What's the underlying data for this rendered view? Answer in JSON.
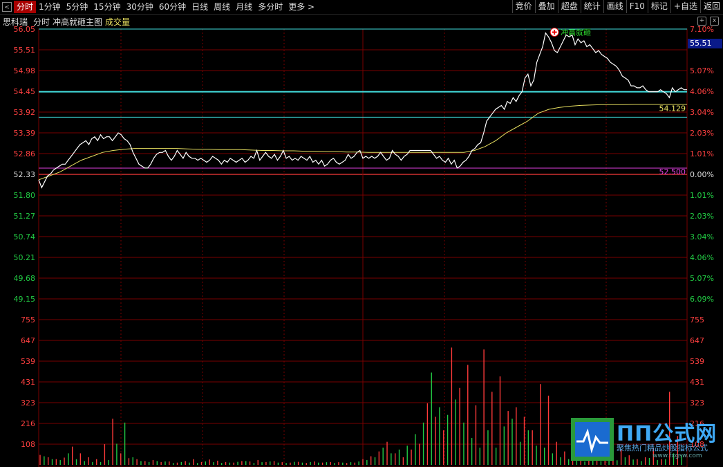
{
  "toolbar": {
    "back_glyph": "<",
    "tabs": [
      "分时",
      "1分钟",
      "5分钟",
      "15分钟",
      "30分钟",
      "60分钟",
      "日线",
      "周线",
      "月线",
      "多分时",
      "更多 >"
    ],
    "active_tab": 0,
    "right_buttons": [
      "竞价",
      "叠加",
      "超盘",
      "统计",
      "画线",
      "F10",
      "标记",
      "+自选",
      "返回"
    ]
  },
  "info": {
    "stock_name": "思科瑞",
    "mode": "分时",
    "indicator": "冲高就砸主图",
    "volume_label": "成交量"
  },
  "controls": {
    "add": "+",
    "close": "x"
  },
  "price_tag": "55.51",
  "colors": {
    "up": "#ff3a3a",
    "down": "#22cc44",
    "price_line": "#ffffff",
    "avg_line": "#e8e060",
    "grid": "#7a0000",
    "cyan": "#40e0e0",
    "magenta": "#e040e0"
  },
  "logo": {
    "title": "ΠΠ公式网",
    "subtitle": "聚焦热门精品炒股指标公式",
    "url": "www.fxgsw.com"
  },
  "chart_data": {
    "type": "line",
    "title": "",
    "price_axis": {
      "left": [
        "56.05",
        "55.51",
        "54.98",
        "54.45",
        "53.92",
        "53.39",
        "52.86",
        "52.33",
        "51.80",
        "51.27",
        "50.74",
        "50.21",
        "49.68",
        "49.15"
      ],
      "right": [
        "7.10%",
        "6.09%",
        "5.07%",
        "4.06%",
        "3.04%",
        "2.03%",
        "1.01%",
        "0.00%",
        "1.01%",
        "2.03%",
        "3.04%",
        "4.06%",
        "5.07%",
        "6.09%"
      ]
    },
    "volume_axis": [
      "755",
      "647",
      "539",
      "431",
      "323",
      "216",
      "108"
    ],
    "prev_close": 52.33,
    "level_lines": [
      {
        "value": 56.05
      },
      {
        "value": 54.45
      },
      {
        "value": 53.8
      },
      {
        "value": 52.5,
        "label": "52.500"
      }
    ],
    "avg_label": "54.129",
    "signal": {
      "text": "冲高就砸",
      "time_index": 175,
      "price": 55.9
    },
    "price_series": [
      52.2,
      52.0,
      52.15,
      52.3,
      52.35,
      52.45,
      52.5,
      52.55,
      52.6,
      52.6,
      52.7,
      52.8,
      52.9,
      53.0,
      53.1,
      53.15,
      53.2,
      53.1,
      53.25,
      53.3,
      53.2,
      53.35,
      53.25,
      53.3,
      53.3,
      53.2,
      53.3,
      53.4,
      53.35,
      53.25,
      53.2,
      53.1,
      52.9,
      52.75,
      52.6,
      52.55,
      52.5,
      52.5,
      52.6,
      52.75,
      52.85,
      52.9,
      52.9,
      52.95,
      52.8,
      52.7,
      52.8,
      52.95,
      52.85,
      52.75,
      52.9,
      52.8,
      52.75,
      52.75,
      52.7,
      52.75,
      52.7,
      52.65,
      52.7,
      52.8,
      52.75,
      52.7,
      52.6,
      52.7,
      52.65,
      52.75,
      52.7,
      52.65,
      52.7,
      52.75,
      52.65,
      52.7,
      52.8,
      52.75,
      52.95,
      52.7,
      52.8,
      52.9,
      52.8,
      52.75,
      52.85,
      52.7,
      52.8,
      52.95,
      52.75,
      52.8,
      52.7,
      52.75,
      52.7,
      52.8,
      52.75,
      52.7,
      52.8,
      52.65,
      52.7,
      52.6,
      52.7,
      52.55,
      52.6,
      52.7,
      52.75,
      52.65,
      52.6,
      52.65,
      52.7,
      52.85,
      52.75,
      52.8,
      52.9,
      52.95,
      52.75,
      52.8,
      52.75,
      52.8,
      52.75,
      52.8,
      52.9,
      52.8,
      52.7,
      52.75,
      52.95,
      52.85,
      52.8,
      52.7,
      52.8,
      52.85,
      52.95,
      52.95,
      52.95,
      52.95,
      52.95,
      52.95,
      52.95,
      52.95,
      52.85,
      52.75,
      52.8,
      52.7,
      52.65,
      52.75,
      52.6,
      52.7,
      52.5,
      52.55,
      52.65,
      52.7,
      52.8,
      52.95,
      53.0,
      53.1,
      53.15,
      53.4,
      53.7,
      53.8,
      53.9,
      54.0,
      54.05,
      54.1,
      54.0,
      54.2,
      54.15,
      54.3,
      54.2,
      54.35,
      54.45,
      54.8,
      54.9,
      54.6,
      54.75,
      55.2,
      55.4,
      55.6,
      55.95,
      55.85,
      55.7,
      55.5,
      55.45,
      55.6,
      55.75,
      55.9,
      55.85,
      55.9,
      55.65,
      55.8,
      55.7,
      55.75,
      55.6,
      55.65,
      55.55,
      55.45,
      55.5,
      55.4,
      55.35,
      55.3,
      55.2,
      55.15,
      55.1,
      55.0,
      54.85,
      54.8,
      54.75,
      54.6,
      54.6,
      54.55,
      54.55,
      54.6,
      54.5,
      54.45,
      54.45,
      54.45,
      54.45,
      54.5,
      54.45,
      54.4,
      54.3,
      54.55,
      54.45,
      54.5,
      54.55,
      54.5,
      54.5
    ],
    "avg_series": [
      52.2,
      52.3,
      52.4,
      52.55,
      52.7,
      52.8,
      52.9,
      52.95,
      52.98,
      53.0,
      53.0,
      53.0,
      53.0,
      53.0,
      52.99,
      52.98,
      52.98,
      52.97,
      52.97,
      52.97,
      52.96,
      52.95,
      52.95,
      52.94,
      52.94,
      52.93,
      52.93,
      52.92,
      52.92,
      52.91,
      52.91,
      52.9,
      52.9,
      52.9,
      52.9,
      52.9,
      52.9,
      52.9,
      52.9,
      52.9,
      52.9,
      52.95,
      53.05,
      53.2,
      53.4,
      53.55,
      53.7,
      53.9,
      54.0,
      54.05,
      54.08,
      54.1,
      54.11,
      54.12,
      54.12,
      54.12,
      54.13,
      54.13,
      54.13,
      54.13,
      54.13,
      54.13
    ],
    "volume": {
      "up": [
        52,
        40,
        30,
        38,
        95,
        60,
        40,
        30,
        108,
        240,
        60,
        35,
        30,
        20,
        25,
        15,
        18,
        12,
        20,
        30,
        15,
        28,
        22,
        15,
        12,
        20,
        18,
        25,
        15,
        20,
        14,
        12,
        16,
        10,
        18,
        12,
        15,
        14,
        10,
        12,
        30,
        45,
        70,
        120,
        60,
        40,
        80,
        110,
        320,
        250,
        180,
        610,
        400,
        520,
        310,
        600,
        380,
        460,
        280,
        300,
        250,
        180,
        420,
        360,
        120,
        70,
        90,
        60,
        45,
        40,
        36,
        180,
        80,
        50,
        30,
        40,
        90,
        30,
        380,
        150
      ],
      "down": [
        45,
        30,
        25,
        60,
        30,
        20,
        15,
        15,
        25,
        110,
        220,
        40,
        20,
        15,
        20,
        18,
        10,
        15,
        12,
        10,
        18,
        14,
        10,
        12,
        16,
        20,
        10,
        14,
        18,
        12,
        10,
        16,
        12,
        15,
        12,
        14,
        10,
        12,
        14,
        18,
        25,
        40,
        90,
        60,
        80,
        100,
        160,
        220,
        480,
        300,
        260,
        340,
        220,
        140,
        90,
        180,
        90,
        200,
        240,
        120,
        180,
        100,
        90,
        60,
        40,
        30,
        22,
        18,
        30,
        20,
        26,
        24,
        40,
        28,
        20,
        36,
        25,
        30,
        60,
        50
      ]
    }
  }
}
